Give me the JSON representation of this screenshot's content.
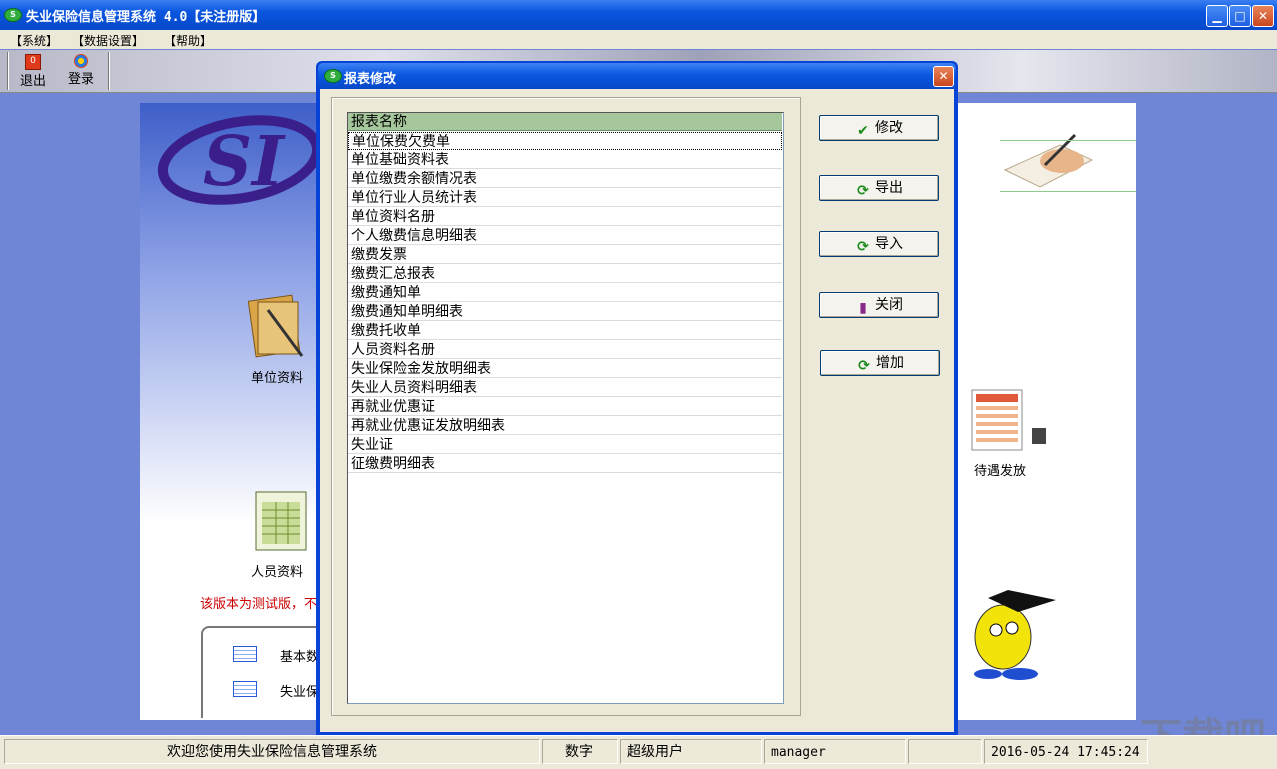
{
  "window": {
    "title": "失业保险信息管理系统  4.0【未注册版】"
  },
  "menu": {
    "items": [
      "【系统】",
      "【数据设置】",
      "【帮助】"
    ]
  },
  "toolbar": {
    "exit": "退出",
    "login": "登录"
  },
  "main": {
    "unit_info": "单位资料",
    "person_info": "人员资料",
    "benefits": "待遇发放",
    "notice": "该版本为测试版，不",
    "quick1": "基本数",
    "quick2": "失业保"
  },
  "dialog": {
    "title": "报表修改",
    "list_header": "报表名称",
    "reports": [
      "单位保费欠费单",
      "单位基础资料表",
      "单位缴费余额情况表",
      "单位行业人员统计表",
      "单位资料名册",
      "个人缴费信息明细表",
      "缴费发票",
      "缴费汇总报表",
      "缴费通知单",
      "缴费通知单明细表",
      "缴费托收单",
      "人员资料名册",
      "失业保险金发放明细表",
      "失业人员资料明细表",
      "再就业优惠证",
      "再就业优惠证发放明细表",
      "失业证",
      "征缴费明细表"
    ],
    "buttons": {
      "modify": "修改",
      "export": "导出",
      "import": "导入",
      "close": "关闭",
      "add": "增加"
    }
  },
  "status": {
    "welcome": "欢迎您使用失业保险信息管理系统",
    "numlock": "数字",
    "role": "超级用户",
    "user": "manager",
    "datetime": "2016-05-24 17:45:24"
  },
  "watermark": "下载吧",
  "colors": {
    "titlebar": "#0a55df",
    "list_header": "#a5c79b",
    "notice": "#cc0000",
    "desktop": "#6f86d6"
  }
}
